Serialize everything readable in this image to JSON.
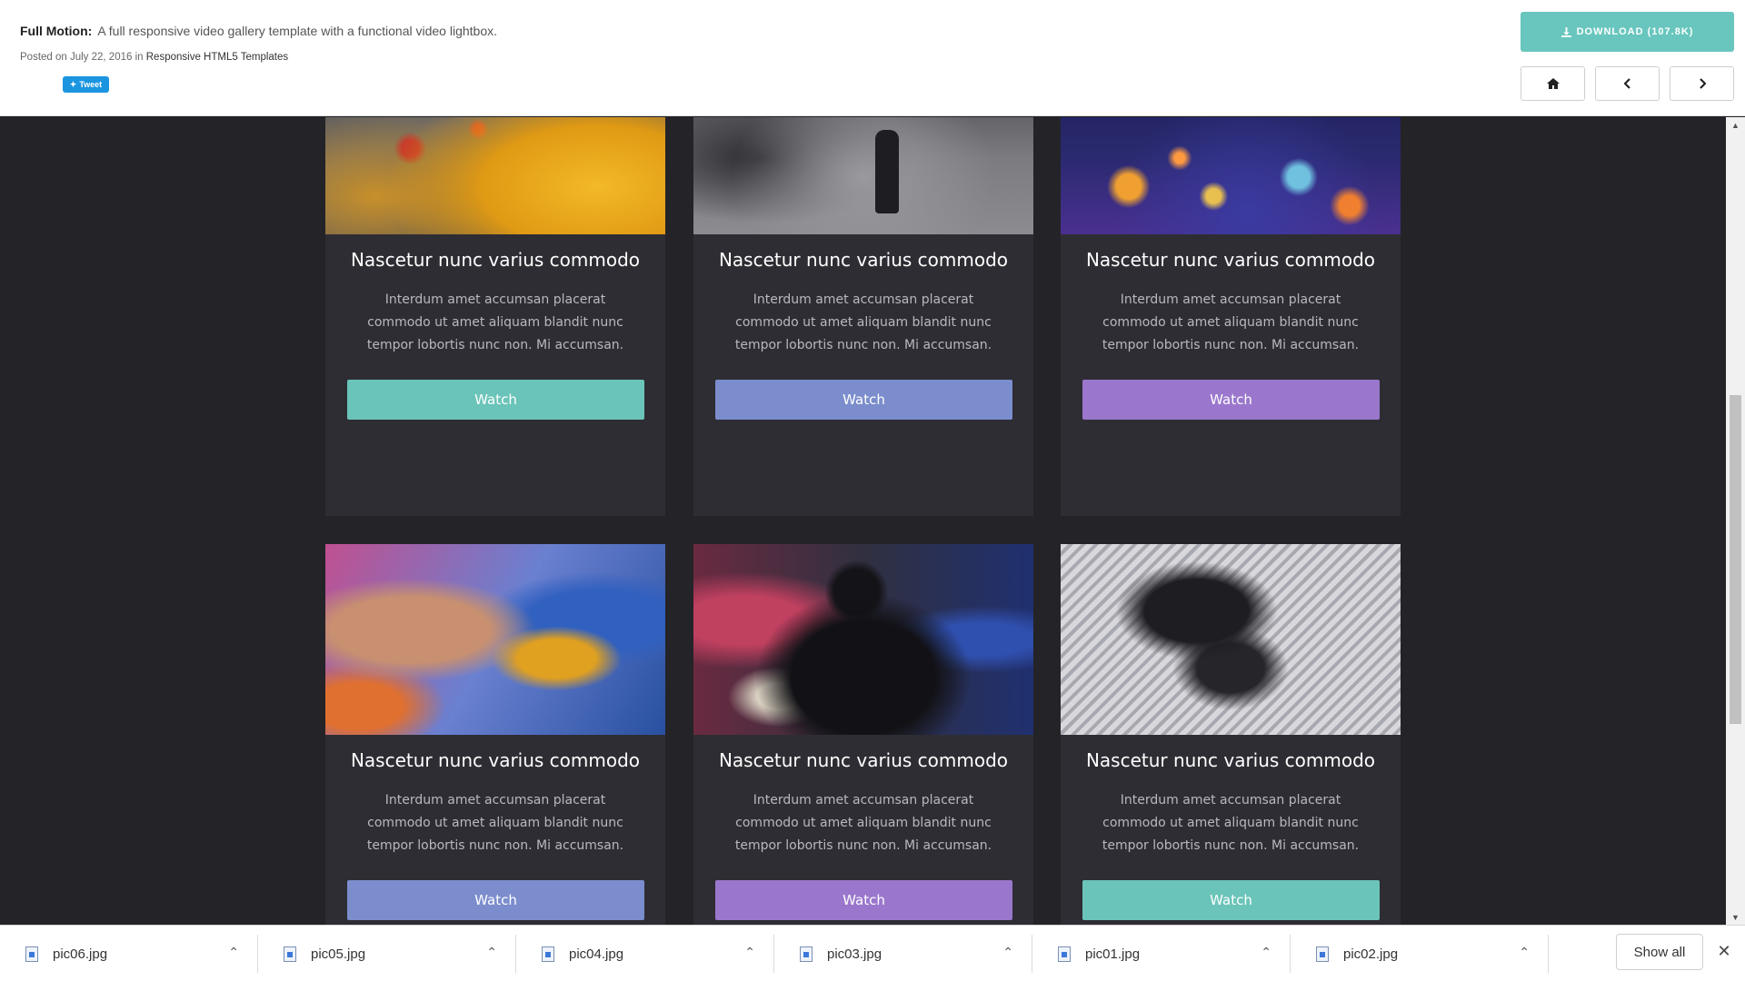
{
  "header": {
    "product_name": "Full Motion:",
    "description": "A full responsive video gallery template with a functional video lightbox.",
    "posted_prefix": "Posted on July 22, 2016 in",
    "category_link": "Responsive HTML5 Templates",
    "tweet_label": "Tweet",
    "download_label": "DOWNLOAD (107.8K)",
    "nav": [
      "home-icon",
      "chevron-left-icon",
      "chevron-right-icon"
    ]
  },
  "gallery": {
    "cards": [
      {
        "title": "Nascetur nunc varius commodo",
        "text": "Interdum amet accumsan placerat commodo ut amet aliquam blandit nunc tempor lobortis nunc non. Mi accumsan.",
        "button": "Watch",
        "button_color": "#6bc4b9",
        "image": "taxi-traffic-photo"
      },
      {
        "title": "Nascetur nunc varius commodo",
        "text": "Interdum amet accumsan placerat commodo ut amet aliquam blandit nunc tempor lobortis nunc non. Mi accumsan.",
        "button": "Watch",
        "button_color": "#7b8dcc",
        "image": "skateboarder-street-photo"
      },
      {
        "title": "Nascetur nunc varius commodo",
        "text": "Interdum amet accumsan placerat commodo ut amet aliquam blandit nunc tempor lobortis nunc non. Mi accumsan.",
        "button": "Watch",
        "button_color": "#9a77cc",
        "image": "city-lights-bokeh-photo"
      },
      {
        "title": "Nascetur nunc varius commodo",
        "text": "Interdum amet accumsan placerat commodo ut amet aliquam blandit nunc tempor lobortis nunc non. Mi accumsan.",
        "button": "Watch",
        "button_color": "#7b8dcc",
        "image": "mural-woman-photo"
      },
      {
        "title": "Nascetur nunc varius commodo",
        "text": "Interdum amet accumsan placerat commodo ut amet aliquam blandit nunc tempor lobortis nunc non. Mi accumsan.",
        "button": "Watch",
        "button_color": "#9a77cc",
        "image": "hooded-man-neon-photo"
      },
      {
        "title": "Nascetur nunc varius commodo",
        "text": "Interdum amet accumsan placerat commodo ut amet aliquam blandit nunc tempor lobortis nunc non. Mi accumsan.",
        "button": "Watch",
        "button_color": "#6bc4b9",
        "image": "sneakers-fire-escape-photo"
      }
    ]
  },
  "downloads": {
    "items": [
      "pic06.jpg",
      "pic05.jpg",
      "pic04.jpg",
      "pic03.jpg",
      "pic01.jpg",
      "pic02.jpg"
    ],
    "show_all_label": "Show all"
  },
  "colors": {
    "page_bg": "#242328",
    "card_bg": "#2e2d33",
    "download_button": "#68c6be",
    "tweet_button": "#1b95e0"
  }
}
